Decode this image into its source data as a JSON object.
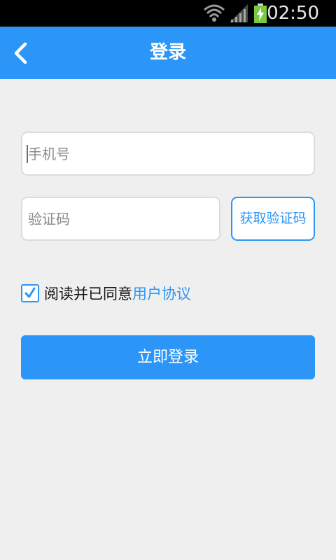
{
  "status_bar": {
    "time": "02:50",
    "icons": [
      "wifi-icon",
      "signal-icon",
      "battery-charging-icon"
    ]
  },
  "app_bar": {
    "title": "登录",
    "back_icon": "chevron-left-icon"
  },
  "form": {
    "phone_placeholder": "手机号",
    "phone_value": "",
    "code_placeholder": "验证码",
    "code_value": "",
    "get_code_label": "获取验证码"
  },
  "agreement": {
    "checked": true,
    "text": "阅读并已同意",
    "link_label": "用户协议"
  },
  "login_button_label": "立即登录",
  "colors": {
    "accent": "#2b96f8",
    "background": "#efefef",
    "status_bar": "#000000",
    "battery": "#7ac943"
  }
}
